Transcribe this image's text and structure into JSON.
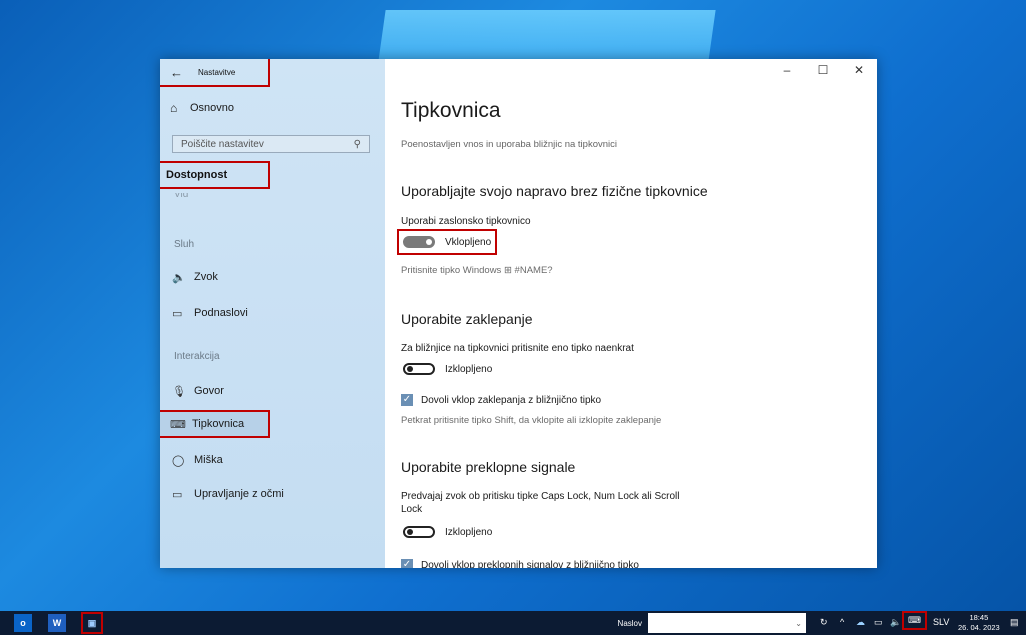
{
  "window": {
    "back_label": "Nastavitve",
    "home_label": "Osnovno",
    "search_placeholder": "Poiščite nastavitev",
    "section": "Dostopnost",
    "faded_item": "Vid",
    "groups": {
      "hearing": "Sluh",
      "interaction": "Interakcija"
    },
    "nav": {
      "sound": "Zvok",
      "captions": "Podnaslovi",
      "speech": "Govor",
      "keyboard": "Tipkovnica",
      "mouse": "Miška",
      "eye_control": "Upravljanje z očmi"
    },
    "controls": {
      "minimize": "–",
      "maximize": "☐",
      "close": "✕"
    }
  },
  "content": {
    "title": "Tipkovnica",
    "subtitle": "Poenostavljen vnos in uporaba bližnjic na tipkovnici",
    "section1": {
      "heading": "Uporabljajte svojo napravo brez fizične tipkovnice",
      "label": "Uporabi zaslonsko tipkovnico",
      "toggle_state": "Vklopljeno",
      "hint": "Pritisnite tipko Windows ⊞ #NAME?"
    },
    "section2": {
      "heading": "Uporabite zaklepanje",
      "label": "Za bližnjice na tipkovnici pritisnite eno tipko naenkrat",
      "toggle_state": "Izklopljeno",
      "checkbox_label": "Dovoli vklop zaklepanja z bližnjično tipko",
      "hint": "Petkrat pritisnite tipko Shift, da vklopite ali izklopite zaklepanje"
    },
    "section3": {
      "heading": "Uporabite preklopne signale",
      "label": "Predvajaj zvok ob pritisku tipke Caps Lock, Num Lock ali Scroll Lock",
      "toggle_state": "Izklopljeno",
      "checkbox_label": "Dovoli vklop preklopnih signalov z bližnjično tipko"
    }
  },
  "taskbar": {
    "search_label": "Naslov",
    "language": "SLV",
    "time": "18:45",
    "date": "26. 04. 2023"
  }
}
